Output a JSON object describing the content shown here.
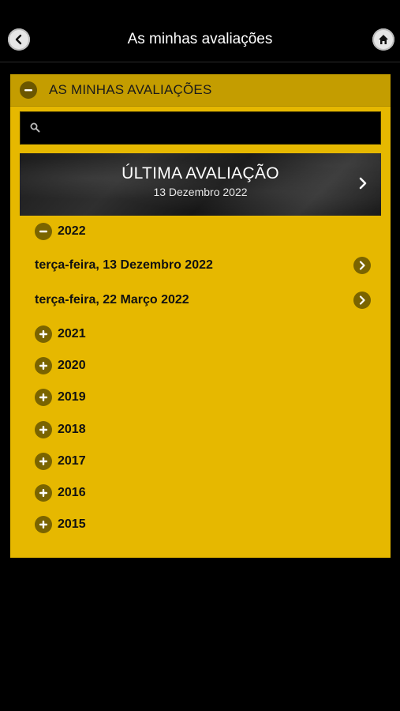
{
  "header": {
    "title": "As minhas avaliações",
    "back_icon": "chevron-left-icon",
    "home_icon": "home-icon"
  },
  "panel": {
    "title": "AS MINHAS AVALIAÇÕES",
    "search": {
      "placeholder": "",
      "value": ""
    },
    "last_evaluation": {
      "title": "ÚLTIMA AVALIAÇÃO",
      "date": "13 Dezembro 2022"
    },
    "expanded_year": {
      "year": "2022",
      "items": [
        {
          "label": "terça-feira, 13 Dezembro 2022"
        },
        {
          "label": "terça-feira, 22 Março 2022"
        }
      ]
    },
    "collapsed_years": [
      "2021",
      "2020",
      "2019",
      "2018",
      "2017",
      "2016",
      "2015"
    ]
  },
  "colors": {
    "accent": "#e6b800",
    "header_band": "#c49d00",
    "icon_circle": "#7a6400",
    "background": "#000000"
  }
}
